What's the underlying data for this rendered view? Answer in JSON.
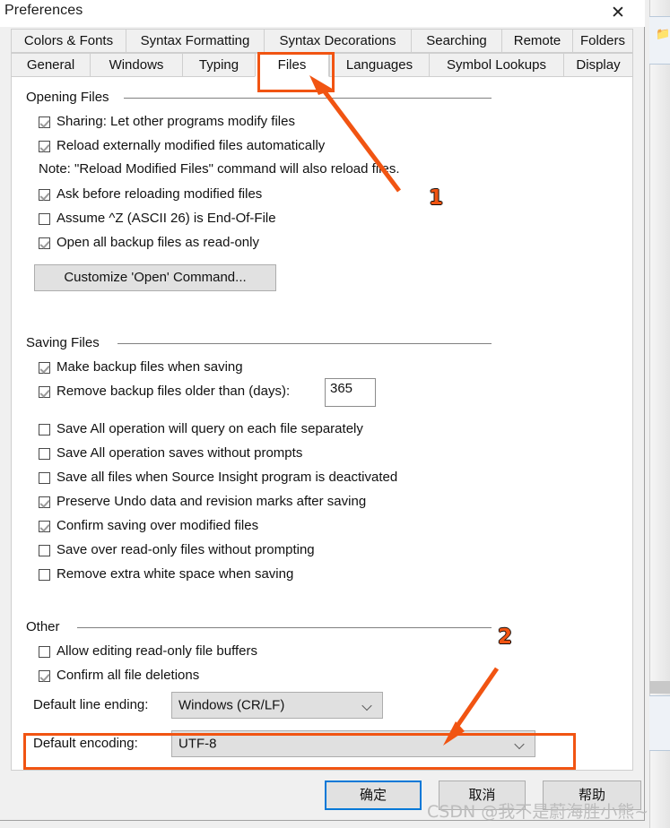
{
  "window": {
    "title": "Preferences",
    "close_icon": "close-icon"
  },
  "tabs": {
    "row1": [
      {
        "label": "Colors & Fonts",
        "width": 128
      },
      {
        "label": "Syntax Formatting",
        "width": 154
      },
      {
        "label": "Syntax Decorations",
        "width": 164
      },
      {
        "label": "Searching",
        "width": 101
      },
      {
        "label": "Remote",
        "width": 79
      },
      {
        "label": "Folders",
        "width": 68
      }
    ],
    "row2": [
      {
        "label": "General",
        "width": 88
      },
      {
        "label": "Windows",
        "width": 103
      },
      {
        "label": "Typing",
        "width": 81
      },
      {
        "label": "Files",
        "width": 83,
        "selected": true
      },
      {
        "label": "Languages",
        "width": 111
      },
      {
        "label": "Symbol Lookups",
        "width": 150
      },
      {
        "label": "Display",
        "width": 78
      }
    ]
  },
  "groups": {
    "opening": {
      "title": "Opening Files",
      "items": [
        {
          "label": "Sharing: Let other programs modify files",
          "checked": true
        },
        {
          "label": "Reload externally modified files automatically",
          "checked": true
        }
      ],
      "note": "Note: \"Reload Modified Files\" command will also reload files.",
      "items2": [
        {
          "label": "Ask before reloading modified files",
          "checked": true
        },
        {
          "label": "Assume ^Z (ASCII 26) is End-Of-File",
          "checked": false
        },
        {
          "label": "Open all backup files as read-only",
          "checked": true
        }
      ],
      "button": "Customize 'Open' Command..."
    },
    "saving": {
      "title": "Saving Files",
      "items": [
        {
          "label": "Make backup files when saving",
          "checked": true
        },
        {
          "label": "Remove backup files older than (days):",
          "checked": true
        }
      ],
      "days_value": "365",
      "items2": [
        {
          "label": "Save All operation will query on each file separately",
          "checked": false
        },
        {
          "label": "Save All operation saves without prompts",
          "checked": false
        },
        {
          "label": "Save all files when Source Insight program is deactivated",
          "checked": false
        },
        {
          "label": "Preserve Undo data and revision marks after saving",
          "checked": true
        },
        {
          "label": "Confirm saving over modified files",
          "checked": true
        },
        {
          "label": "Save over read-only files without prompting",
          "checked": false
        },
        {
          "label": "Remove extra white space when saving",
          "checked": false
        }
      ]
    },
    "other": {
      "title": "Other",
      "items": [
        {
          "label": "Allow editing read-only file buffers",
          "checked": false
        },
        {
          "label": "Confirm all file deletions",
          "checked": true
        }
      ],
      "line_ending_label": "Default line ending:",
      "line_ending_value": "Windows (CR/LF)",
      "encoding_label": "Default encoding:",
      "encoding_value": "UTF-8"
    }
  },
  "footer": {
    "ok": "确定",
    "cancel": "取消",
    "help": "帮助"
  },
  "annotations": {
    "num1": "1",
    "num2": "2",
    "accent": "#f15412"
  },
  "watermark": "CSDN @我不是蔚海胜小熊~",
  "background": {
    "toolbar_icon": "new-folder-icon"
  }
}
